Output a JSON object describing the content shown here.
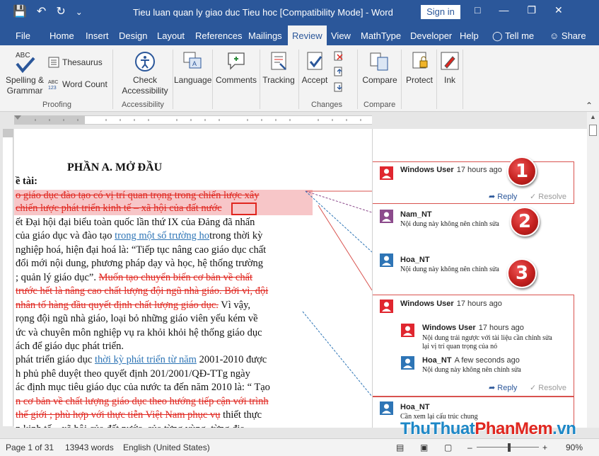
{
  "window": {
    "title": "Tieu luan quan ly giao duc Tieu hoc [Compatibility Mode]  -  Word",
    "signin": "Sign in",
    "controls": [
      "—",
      "❐",
      "✕"
    ]
  },
  "qat": {
    "save": "💾",
    "undo": "↶",
    "redo": "↻",
    "customize": "⌄"
  },
  "tabs": [
    "File",
    "Home",
    "Insert",
    "Design",
    "Layout",
    "References",
    "Mailings",
    "Review",
    "View",
    "MathType",
    "Developer",
    "Help"
  ],
  "tell_me": "Tell me",
  "share": "Share",
  "ribbon": {
    "spelling": [
      "Spelling &",
      "Grammar"
    ],
    "thesaurus": "Thesaurus",
    "word_count": "Word Count",
    "check_accessibility": [
      "Check",
      "Accessibility"
    ],
    "language": "Language",
    "comments": "Comments",
    "tracking": "Tracking",
    "accept": "Accept",
    "compare": "Compare",
    "protect": "Protect",
    "ink": "Ink",
    "groups": [
      "Proofing",
      "Accessibility",
      "Changes",
      "Compare"
    ]
  },
  "document": {
    "heading": "PHẦN A.  MỞ ĐẦU",
    "sub": "ề tài:",
    "lines": [
      [
        {
          "t": "o giáo dục đào tạo có vị trí quan trọng trong chiến lược xây",
          "s": "del"
        }
      ],
      [
        {
          "t": "chiến lược phát triển kinh tế – xã hội của đất nước",
          "s": "del"
        }
      ],
      [
        {
          "t": "ết Đại hội đại biểu toàn quốc lần thứ IX của Đảng đã nhấn",
          "s": ""
        }
      ],
      [
        {
          "t": "của giáo dục và đào tạo ",
          "s": ""
        },
        {
          "t": "trong một số trường ho",
          "s": "ins"
        },
        {
          "t": "trong thời kỳ",
          "s": ""
        }
      ],
      [
        {
          "t": "nghiệp hoá, hiện đại hoá là: “Tiếp tục nâng cao giáo dục chất",
          "s": ""
        }
      ],
      [
        {
          "t": "đổi mới nội dung, phương pháp dạy và học, hệ thống trường",
          "s": ""
        }
      ],
      [
        {
          "t": "; quản lý giáo dục”. ",
          "s": ""
        },
        {
          "t": "Muốn tạo chuyển biến cơ bản về chất",
          "s": "del"
        }
      ],
      [
        {
          "t": "trước hết là nâng cao chất lượng đội ngũ nhà giáo. Bởi vì, đội",
          "s": "del"
        }
      ],
      [
        {
          "t": "nhân tố hàng đầu quyết định chất lượng giáo dục.",
          "s": "del"
        },
        {
          "t": " Vì vậy,",
          "s": ""
        }
      ],
      [
        {
          "t": "rọng đội ngũ nhà giáo, loại bỏ những giáo viên yếu kém về",
          "s": ""
        }
      ],
      [
        {
          "t": "ức và chuyên môn nghiệp vụ ra khỏi khỏi hệ thống giáo dục",
          "s": ""
        }
      ],
      [
        {
          "t": "ách để giáo dục phát triển.",
          "s": ""
        }
      ],
      [
        {
          "t": "phát triển giáo dục ",
          "s": ""
        },
        {
          "t": "thời kỳ phát triển từ năm",
          "s": "ins"
        },
        {
          "t": " 2001-2010 được",
          "s": ""
        }
      ],
      [
        {
          "t": "h phủ phê duyệt theo quyết định 201/2001/QĐ-TTg ngày",
          "s": ""
        }
      ],
      [
        {
          "t": "ác định mục tiêu giáo dục của nước ta đến năm 2010 là: “ Tạo",
          "s": ""
        }
      ],
      [
        {
          "t": "n cơ bản về chất lượng giáo dục theo hướng tiếp cận với trình",
          "s": "del"
        }
      ],
      [
        {
          "t": "thế giới ; phù hợp với thực tiễn Việt Nam phục vụ",
          "s": "del"
        },
        {
          "t": " thiết thực",
          "s": ""
        }
      ],
      [
        {
          "t": "n kinh tế – xã hội của đất nước, của từng vùng, từng địa",
          "s": ""
        }
      ]
    ]
  },
  "comments": {
    "c1": {
      "author": "Windows User",
      "time": "17 hours ago",
      "reply": "Reply",
      "resolve": "Resolve"
    },
    "c2": {
      "author": "Nam_NT",
      "text": "Nội dung này không nên chỉnh sửa"
    },
    "c3": {
      "author": "Hoa_NT",
      "text": "Nội dung này không nên chỉnh sửa"
    },
    "c4": {
      "author": "Windows User",
      "time": "17 hours ago",
      "replies": [
        {
          "author": "Windows User",
          "time": "17 hours ago",
          "text1": "Nội dung trái ngược với tài liệu cần chỉnh sửa",
          "text2": "lại vị trí quan trọng của nó"
        },
        {
          "author": "Hoa_NT",
          "time": "A few seconds ago",
          "text1": "Nội dung này không nên chỉnh sửa"
        }
      ],
      "reply": "Reply",
      "resolve": "Resolve"
    },
    "c5": {
      "author": "Hoa_NT",
      "text": "Cần xem lại cấu trúc chung"
    },
    "badges": [
      "1",
      "2",
      "3"
    ]
  },
  "status": {
    "page": "Page 1 of 31",
    "words": "13943 words",
    "language": "English (United States)",
    "zoom": "90%"
  },
  "watermark": {
    "part1": "ThuThuat",
    "part2": "PhanMem",
    "part3": ".vn"
  },
  "colors": {
    "brand": "#2b579a",
    "deletion": "#e0261f",
    "insertion": "#2e75b6",
    "comment_border": "#d9534f"
  }
}
